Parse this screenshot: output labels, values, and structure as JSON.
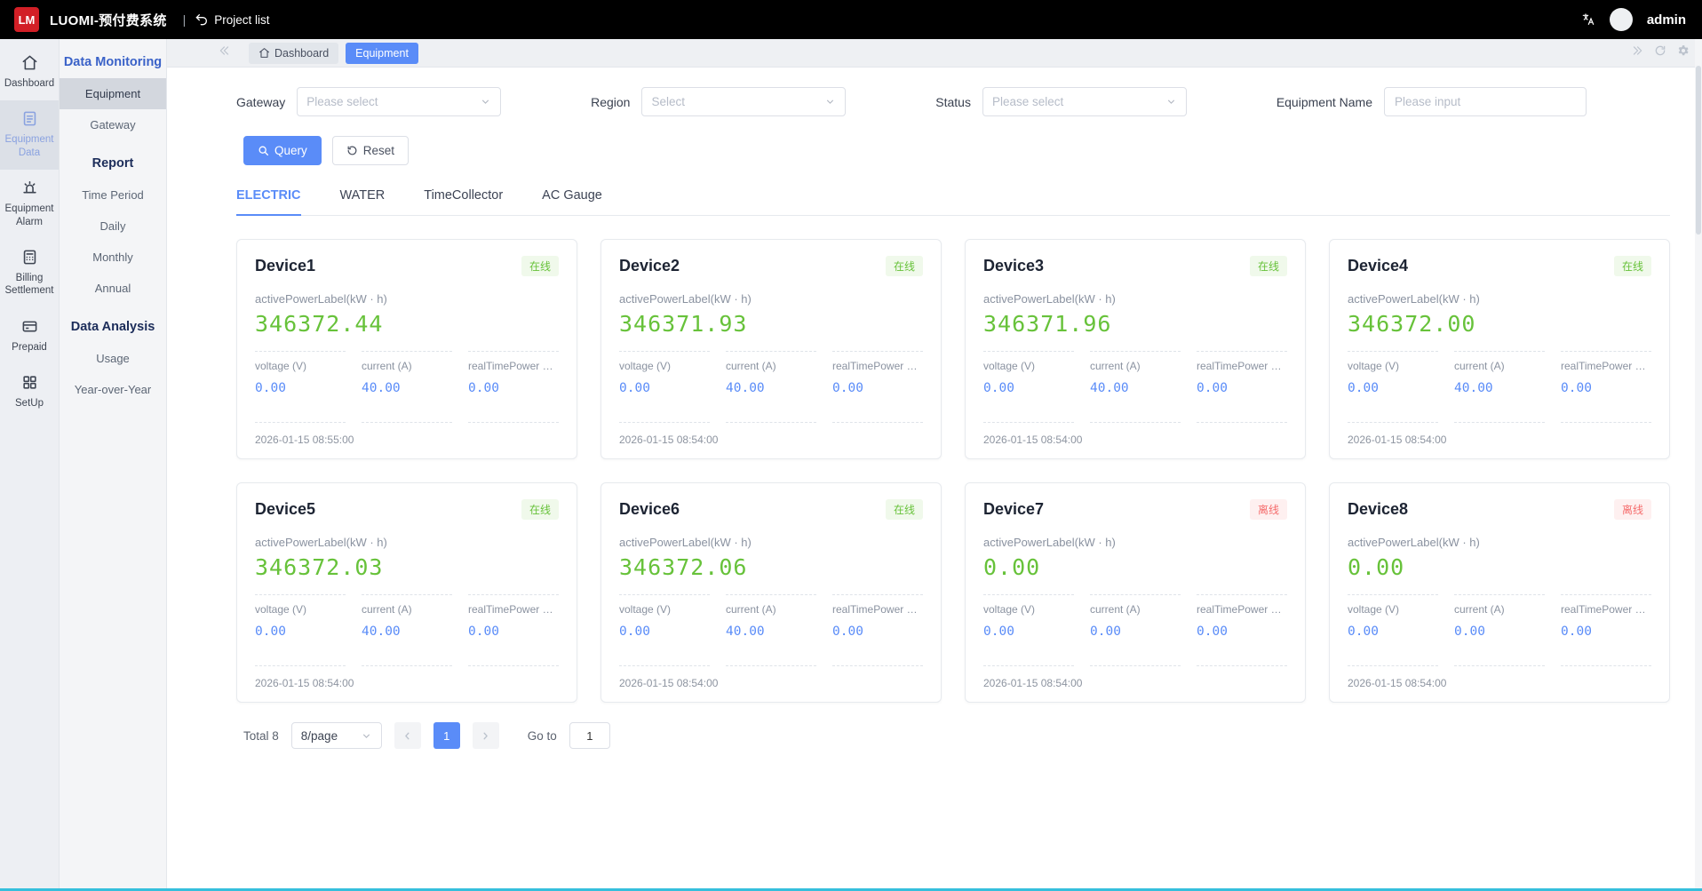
{
  "colors": {
    "accent": "#5a8cf8",
    "power_green": "#67c23a",
    "online_bg": "#f0f9eb",
    "online_text": "#67c23a",
    "offline_bg": "#fef0f0",
    "offline_text": "#f56c6c",
    "logo_red": "#d21f26",
    "topbar_bg": "#000000",
    "bottom_accent": "#35bfdc"
  },
  "icons": {
    "home-icon": "house",
    "equipment-data-icon": "document-lines",
    "equipment-alarm-icon": "alarm-siren",
    "billing-icon": "calculator",
    "prepaid-icon": "credit-card",
    "setup-icon": "grid-squares",
    "back-arrow-icon": "return-arrow",
    "translate-icon": "language-translate",
    "chevron-down-icon": "chevron-down",
    "search-icon": "magnifier",
    "reset-icon": "refresh-circle",
    "refresh-icon": "refresh-circle",
    "settings-gear-icon": "gear",
    "tabs-scroll-left-icon": "double-chevron-left",
    "tabs-scroll-right-icon": "double-chevron-right",
    "prev-icon": "chevron-left",
    "next-icon": "chevron-right"
  },
  "topbar": {
    "logo": "LM",
    "title": "LUOMI-预付费系统",
    "separator": "|",
    "project_list": "Project list",
    "user": "admin"
  },
  "sidebar": {
    "items": [
      {
        "label": "Dashboard",
        "icon": "home-icon",
        "active": false
      },
      {
        "label": "Equipment Data",
        "icon": "equipment-data-icon",
        "active": true
      },
      {
        "label": "Equipment Alarm",
        "icon": "equipment-alarm-icon",
        "active": false
      },
      {
        "label": "Billing Settlement",
        "icon": "billing-icon",
        "active": false
      },
      {
        "label": "Prepaid",
        "icon": "prepaid-icon",
        "active": false
      },
      {
        "label": "SetUp",
        "icon": "setup-icon",
        "active": false
      }
    ]
  },
  "submenu": {
    "sections": [
      {
        "title": "Data Monitoring",
        "accent": true,
        "items": [
          {
            "label": "Equipment",
            "active": true
          },
          {
            "label": "Gateway",
            "active": false
          }
        ]
      },
      {
        "title": "Report",
        "accent": false,
        "items": [
          {
            "label": "Time Period",
            "active": false
          },
          {
            "label": "Daily",
            "active": false
          },
          {
            "label": "Monthly",
            "active": false
          },
          {
            "label": "Annual",
            "active": false
          }
        ]
      },
      {
        "title": "Data Analysis",
        "accent": false,
        "items": [
          {
            "label": "Usage",
            "active": false
          },
          {
            "label": "Year-over-Year",
            "active": false
          }
        ]
      }
    ]
  },
  "tabstrip": {
    "tabs": [
      {
        "label": "Dashboard",
        "active": false
      },
      {
        "label": "Equipment",
        "active": true
      }
    ]
  },
  "filters": {
    "gateway": {
      "label": "Gateway",
      "placeholder": "Please select"
    },
    "region": {
      "label": "Region",
      "placeholder": "Select"
    },
    "status": {
      "label": "Status",
      "placeholder": "Please select"
    },
    "equipment_name": {
      "label": "Equipment Name",
      "placeholder": "Please input"
    },
    "query_label": "Query",
    "reset_label": "Reset"
  },
  "content_tabs": [
    {
      "label": "ELECTRIC",
      "active": true
    },
    {
      "label": "WATER",
      "active": false
    },
    {
      "label": "TimeCollector",
      "active": false
    },
    {
      "label": "AC Gauge",
      "active": false
    }
  ],
  "cards": {
    "power_label": "activePowerLabel(kW · h)",
    "voltage_label": "voltage (V)",
    "current_label": "current (A)",
    "realtime_label": "realTimePower …",
    "devices": [
      {
        "name": "Device1",
        "status": "在线",
        "state": "online",
        "power": "346372.44",
        "voltage": "0.00",
        "current": "40.00",
        "realtime": "0.00",
        "time": "2026-01-15 08:55:00"
      },
      {
        "name": "Device2",
        "status": "在线",
        "state": "online",
        "power": "346371.93",
        "voltage": "0.00",
        "current": "40.00",
        "realtime": "0.00",
        "time": "2026-01-15 08:54:00"
      },
      {
        "name": "Device3",
        "status": "在线",
        "state": "online",
        "power": "346371.96",
        "voltage": "0.00",
        "current": "40.00",
        "realtime": "0.00",
        "time": "2026-01-15 08:54:00"
      },
      {
        "name": "Device4",
        "status": "在线",
        "state": "online",
        "power": "346372.00",
        "voltage": "0.00",
        "current": "40.00",
        "realtime": "0.00",
        "time": "2026-01-15 08:54:00"
      },
      {
        "name": "Device5",
        "status": "在线",
        "state": "online",
        "power": "346372.03",
        "voltage": "0.00",
        "current": "40.00",
        "realtime": "0.00",
        "time": "2026-01-15 08:54:00"
      },
      {
        "name": "Device6",
        "status": "在线",
        "state": "online",
        "power": "346372.06",
        "voltage": "0.00",
        "current": "40.00",
        "realtime": "0.00",
        "time": "2026-01-15 08:54:00"
      },
      {
        "name": "Device7",
        "status": "离线",
        "state": "offline",
        "power": "0.00",
        "voltage": "0.00",
        "current": "0.00",
        "realtime": "0.00",
        "time": "2026-01-15 08:54:00"
      },
      {
        "name": "Device8",
        "status": "离线",
        "state": "offline",
        "power": "0.00",
        "voltage": "0.00",
        "current": "0.00",
        "realtime": "0.00",
        "time": "2026-01-15 08:54:00"
      }
    ]
  },
  "pagination": {
    "total": "Total 8",
    "per_page": "8/page",
    "page": "1",
    "goto_label": "Go to",
    "goto_value": "1"
  }
}
